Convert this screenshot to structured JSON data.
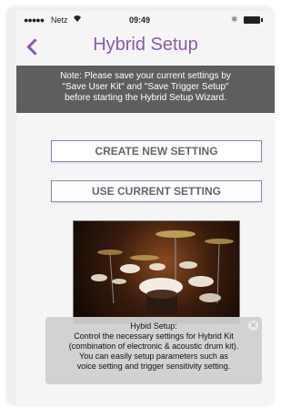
{
  "status_bar": {
    "carrier": "Netz",
    "time": "09:49",
    "signal_dots": "●●●●●"
  },
  "nav": {
    "title": "Hybrid Setup",
    "back_icon": "chevron-left-icon"
  },
  "note": {
    "line1": "Note: Please save your current settings by",
    "line2": "\"Save User Kit\" and \"Save Trigger Setup\"",
    "line3": "before starting the Hybrid Setup Wizard."
  },
  "buttons": {
    "create": "CREATE NEW SETTING",
    "current": "USE CURRENT SETTING"
  },
  "info": {
    "title": "Hybid Setup:",
    "line1": "Control the necessary settings for Hybrid Kit",
    "line2": "(combination of electronic & acoustic drum kit).",
    "line3": "You can easily setup parameters such as",
    "line4": "voice setting and trigger sensitivity setting."
  },
  "colors": {
    "accent": "#8a5aa8",
    "note_bg": "#5e5e5e",
    "info_bg": "#d0d0d0"
  }
}
